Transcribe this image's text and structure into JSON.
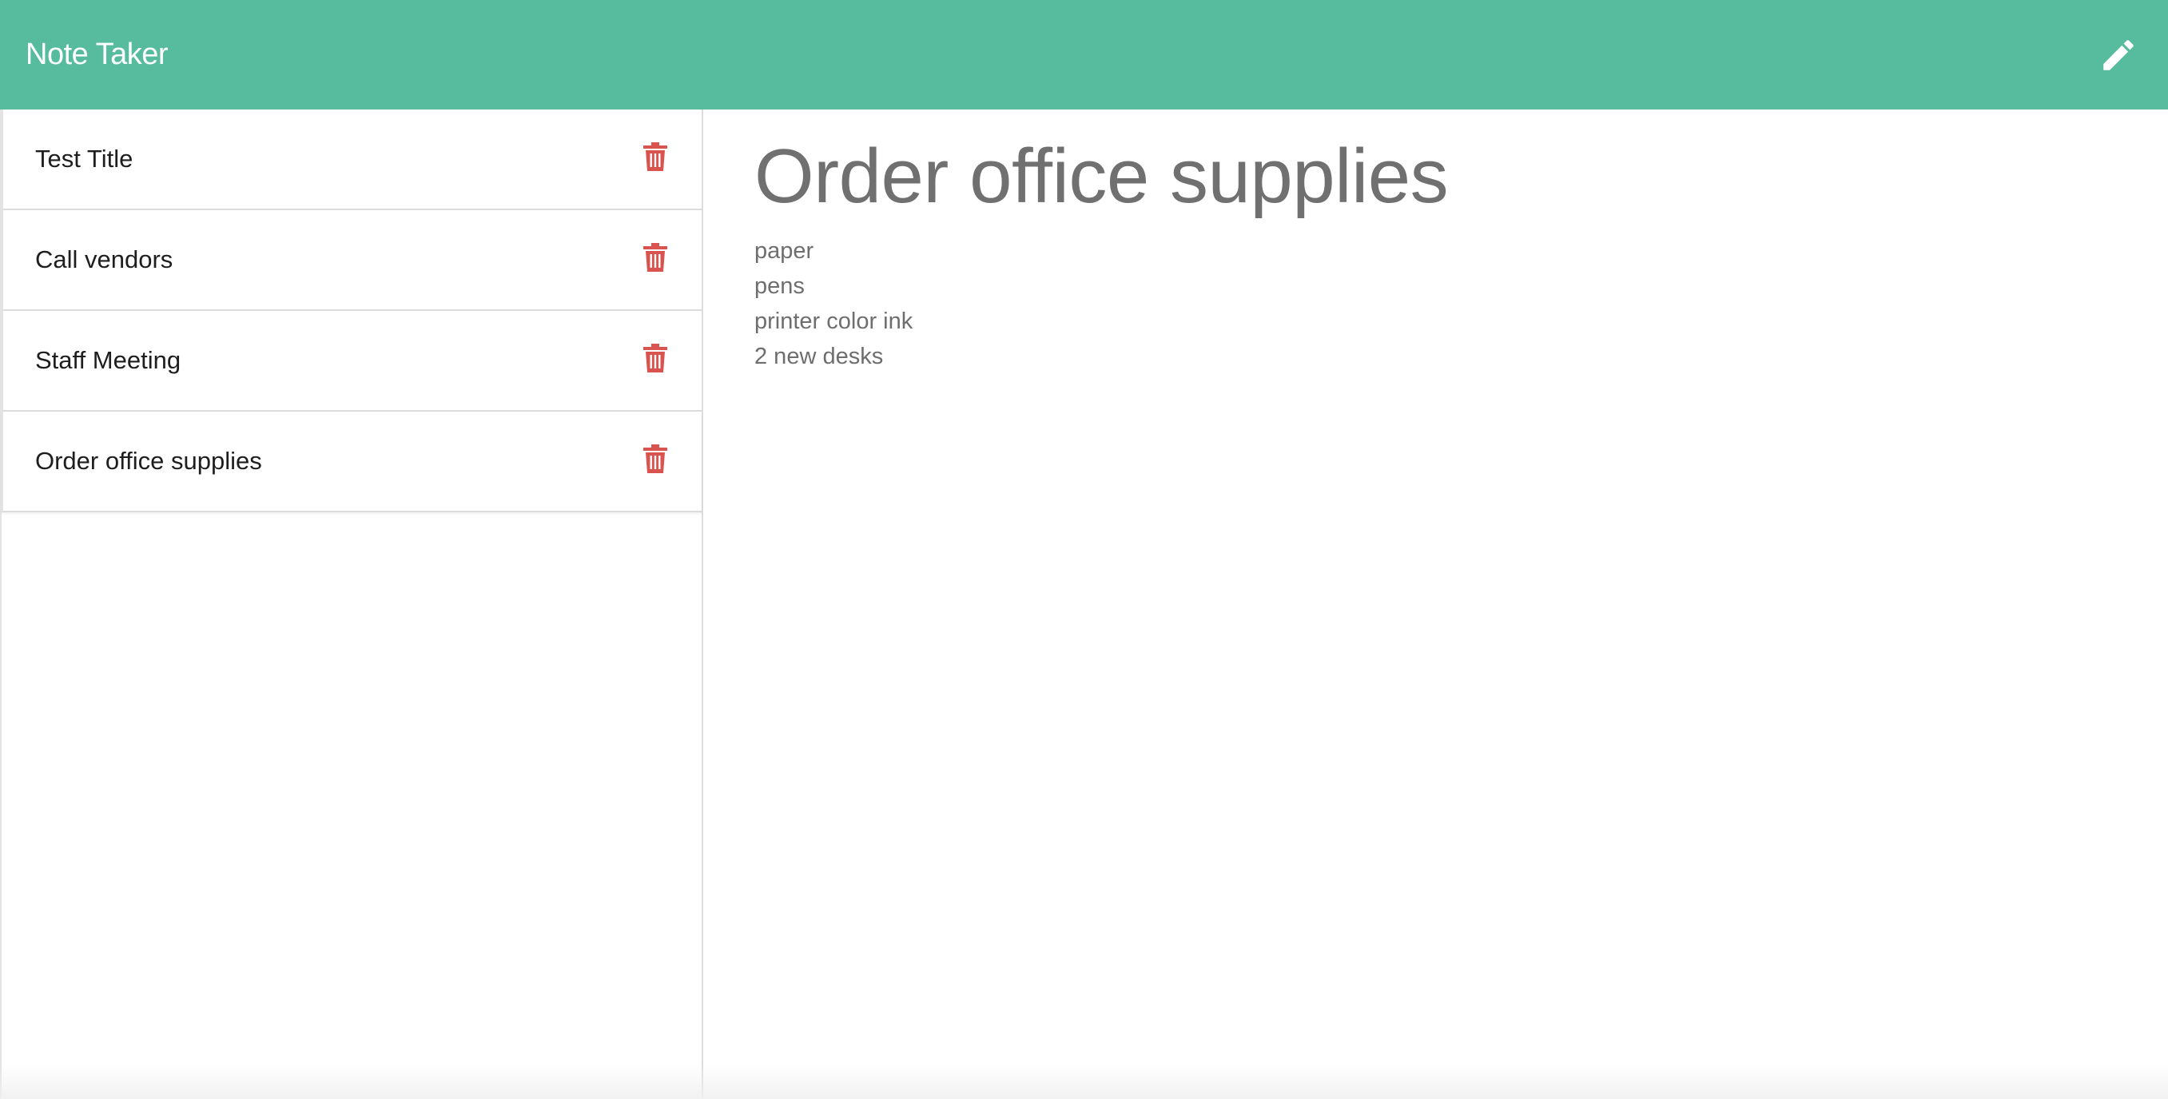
{
  "app": {
    "title": "Note Taker",
    "accent_color": "#57bb9e",
    "delete_color": "#d9534f"
  },
  "header": {
    "new_note_icon": "pencil-icon"
  },
  "notes": [
    {
      "title": "Test Title",
      "icon": "trash-icon"
    },
    {
      "title": "Call vendors",
      "icon": "trash-icon"
    },
    {
      "title": "Staff Meeting",
      "icon": "trash-icon"
    },
    {
      "title": "Order office supplies",
      "icon": "trash-icon"
    }
  ],
  "active_note": {
    "title": "Order office supplies",
    "body_lines": [
      "paper",
      "pens",
      "printer color ink",
      "2 new desks"
    ]
  }
}
